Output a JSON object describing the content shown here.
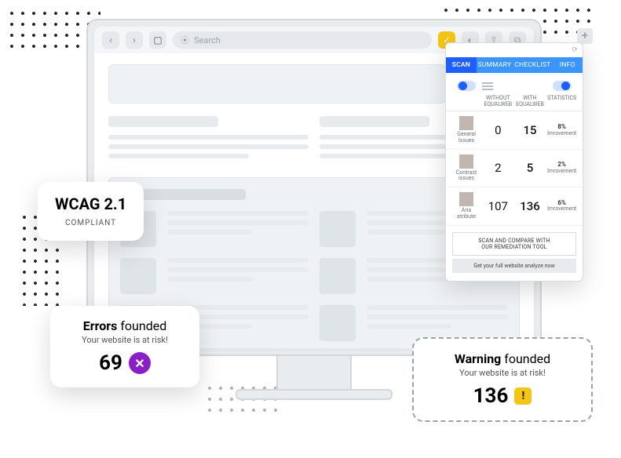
{
  "toolbar": {
    "search_placeholder": "Search",
    "back_glyph": "‹",
    "fwd_glyph": "›",
    "sidebar_glyph": "▢",
    "search_glyph": "⦿",
    "ext_glyph": "✓",
    "shield_glyph": "◐",
    "share_glyph": "⇪",
    "tabs_glyph": "⧉",
    "plus_glyph": "+"
  },
  "panel": {
    "refresh_glyph": "⟳",
    "tabs": {
      "scan": "SCAN",
      "summary": "SUMMARY",
      "checklist": "CHECKLIST",
      "info": "INFO"
    },
    "head": {
      "spacer": "",
      "without": "WITHOUT EQUALWEB",
      "with": "WITH EQUALWEB",
      "stats": "STATISTICS"
    },
    "rows": [
      {
        "label1": "General",
        "label2": "Issues",
        "without": "0",
        "with": "15",
        "pct": "8%",
        "pct_label": "Imrovement"
      },
      {
        "label1": "Contrast",
        "label2": "issues",
        "without": "2",
        "with": "5",
        "pct": "2%",
        "pct_label": "Imrovement"
      },
      {
        "label1": "Aria",
        "label2": "atribute",
        "without": "107",
        "with": "136",
        "pct": "6%",
        "pct_label": "Imrovement"
      }
    ],
    "cta1a": "SCAN AND COMPARE WITH",
    "cta1b": "OUR REMEDIATION TOOL",
    "cta2": "Get your full website analyze now"
  },
  "wcag": {
    "title": "WCAG 2.1",
    "sub": "COMPLIANT"
  },
  "errors": {
    "title_bold": "Errors",
    "title_rest": " founded",
    "sub": "Your website is at risk!",
    "value": "69",
    "icon_glyph": "✕"
  },
  "warning": {
    "title_bold": "Warning",
    "title_rest": " founded",
    "sub": "Your website is at risk!",
    "value": "136",
    "icon_glyph": "!"
  }
}
